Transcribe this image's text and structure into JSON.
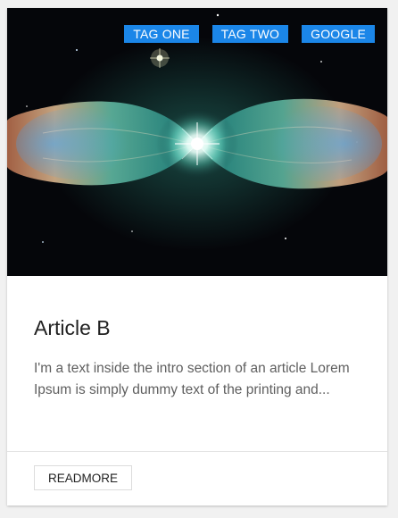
{
  "article": {
    "tags": [
      "TAG ONE",
      "TAG TWO",
      "GOOGLE"
    ],
    "title": "Article B",
    "intro": "I'm a text inside the intro section of an article Lorem Ipsum is simply dummy text of the printing and...",
    "readmore_label": "READMORE"
  },
  "colors": {
    "tag_background": "#1b86e8",
    "image_background": "#05060a"
  },
  "icons": {
    "image": "nebula-image"
  }
}
